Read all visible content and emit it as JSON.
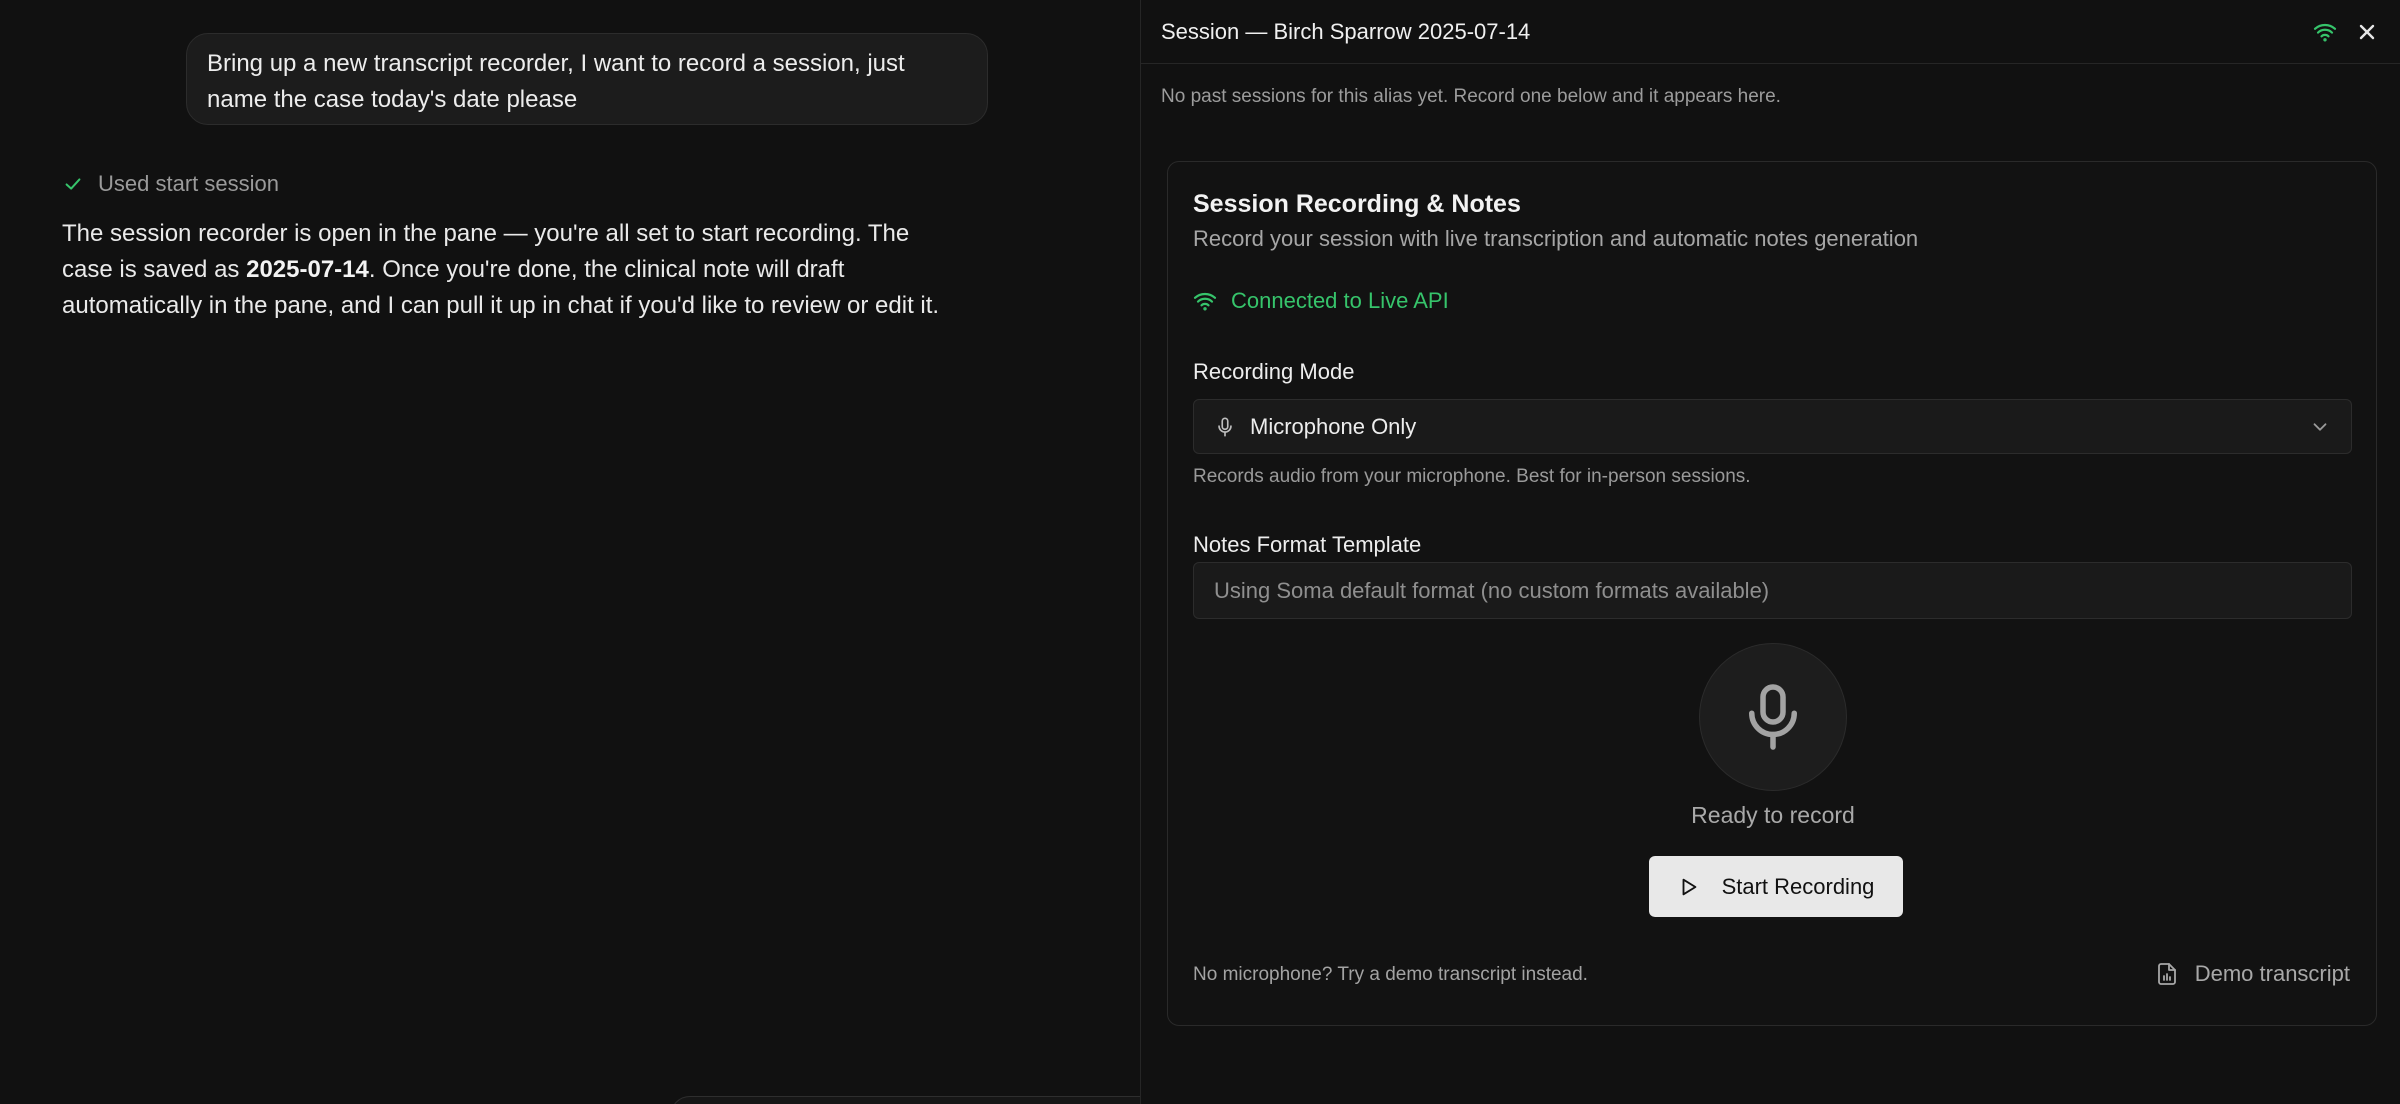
{
  "chat": {
    "user_message": "Bring up a new transcript recorder, I want to record a session, just name the case today's date please",
    "tool_status": "Used start session",
    "assistant": {
      "part1": "The session recorder is open in the pane — you're all set to start recording. The case is saved as ",
      "case_name": "2025-07-14",
      "part2": ". Once you're done, the clinical note will draft automatically in the pane, and I can pull it up in chat if you'd like to review or edit it."
    }
  },
  "pane": {
    "title": "Session — Birch Sparrow 2025-07-14",
    "past_sessions_note": "No past sessions for this alias yet. Record one below and it appears here.",
    "icons": {
      "connection": "wifi-icon",
      "close": "close-icon"
    },
    "card": {
      "title": "Session Recording & Notes",
      "subtitle": "Record your session with live transcription and automatic notes generation",
      "connection_status": "Connected to Live API",
      "recording_mode_label": "Recording Mode",
      "recording_mode_value": "Microphone Only",
      "recording_mode_hint": "Records audio from your microphone. Best for in-person sessions.",
      "notes_format_label": "Notes Format Template",
      "notes_format_value": "Using Soma default format (no custom formats available)",
      "ready_text": "Ready to record",
      "start_button": "Start Recording",
      "demo_note": "No microphone? Try a demo transcript instead.",
      "demo_button": "Demo transcript"
    }
  },
  "colors": {
    "background": "#111111",
    "accent_green": "#36c46b",
    "button_light": "#e8e8e8",
    "border": "#2a2a2a"
  }
}
